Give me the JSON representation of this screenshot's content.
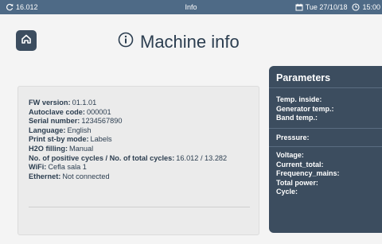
{
  "status_bar": {
    "counter": "16.012",
    "title": "Info",
    "date": "Tue 27/10/18",
    "time": "15:00",
    "icons": [
      "cycle-counter-icon",
      "calendar-icon",
      "clock-icon"
    ]
  },
  "header": {
    "title": "Machine info",
    "icons": [
      "home-icon",
      "info-icon"
    ]
  },
  "machine_info": {
    "rows": [
      {
        "label": "FW version:",
        "value": "01.1.01"
      },
      {
        "label": "Autoclave code:",
        "value": "000001"
      },
      {
        "label": "Serial number:",
        "value": "1234567890"
      },
      {
        "label": "Language:",
        "value": "English"
      },
      {
        "label": "Print st-by mode:",
        "value": "Labels"
      },
      {
        "label": "H2O filling:",
        "value": "Manual"
      },
      {
        "label": "No. of positive cycles / No. of total cycles:",
        "value": "16.012 / 13.282"
      },
      {
        "label": "WiFi:",
        "value": "Cefla sala 1"
      },
      {
        "label": "Ethernet:",
        "value": "Not connected"
      }
    ]
  },
  "parameters": {
    "title": "Parameters",
    "group1": [
      "Temp. inside:",
      "Generator temp.:",
      "Band temp.:"
    ],
    "group2": [
      "Pressure:"
    ],
    "group3": [
      "Voltage:",
      "Current_total:",
      "Frequency_mains:",
      "Total power:",
      "Cycle:"
    ]
  },
  "colors": {
    "status_bar": "#4e6a86",
    "panel_dark": "#3c4d5f",
    "background": "#f4f4f4",
    "text": "#2c3e50"
  }
}
